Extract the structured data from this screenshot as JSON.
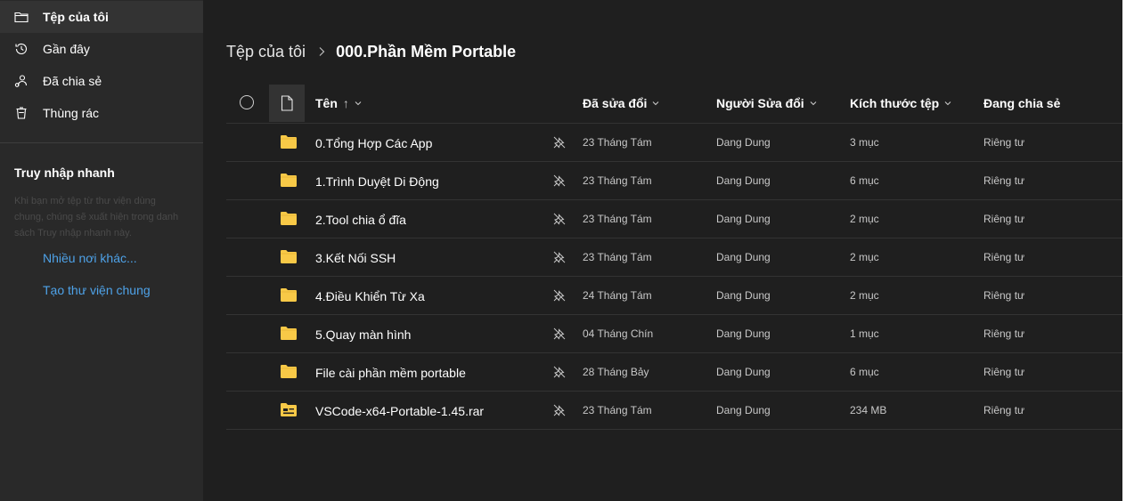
{
  "sidebar": {
    "nav": [
      {
        "label": "Tệp của tôi",
        "icon": "folder-icon"
      },
      {
        "label": "Gần đây",
        "icon": "recent-icon"
      },
      {
        "label": "Đã chia sẻ",
        "icon": "shared-icon"
      },
      {
        "label": "Thùng rác",
        "icon": "recycle-bin-icon"
      }
    ],
    "quick_access": {
      "title": "Truy nhập nhanh",
      "description": "Khi bạn mở tệp từ thư viện dùng chung, chúng sẽ xuất hiện trong danh sách Truy nhập nhanh này.",
      "links": [
        "Nhiều nơi khác...",
        "Tạo thư viện chung"
      ]
    }
  },
  "breadcrumb": {
    "root": "Tệp của tôi",
    "current": "000.Phần Mềm Portable"
  },
  "columns": {
    "name": "Tên",
    "sort_arrow": "↑",
    "modified": "Đã sửa đổi",
    "modified_by": "Người Sửa đổi",
    "size": "Kích thước tệp",
    "sharing": "Đang chia sẻ"
  },
  "files": [
    {
      "name": "0.Tổng Hợp Các App",
      "type": "folder",
      "modified": "23 Tháng Tám",
      "modified_by": "Dang Dung",
      "size": "3 mục",
      "sharing": "Riêng tư"
    },
    {
      "name": "1.Trình Duyệt Di Động",
      "type": "folder",
      "modified": "23 Tháng Tám",
      "modified_by": "Dang Dung",
      "size": "6 mục",
      "sharing": "Riêng tư"
    },
    {
      "name": "2.Tool chia ổ đĩa",
      "type": "folder",
      "modified": "23 Tháng Tám",
      "modified_by": "Dang Dung",
      "size": "2 mục",
      "sharing": "Riêng tư"
    },
    {
      "name": "3.Kết Nối SSH",
      "type": "folder",
      "modified": "23 Tháng Tám",
      "modified_by": "Dang Dung",
      "size": "2 mục",
      "sharing": "Riêng tư"
    },
    {
      "name": "4.Điều Khiển Từ Xa",
      "type": "folder",
      "modified": "24 Tháng Tám",
      "modified_by": "Dang Dung",
      "size": "2 mục",
      "sharing": "Riêng tư"
    },
    {
      "name": "5.Quay màn hình",
      "type": "folder",
      "modified": "04 Tháng Chín",
      "modified_by": "Dang Dung",
      "size": "1 mục",
      "sharing": "Riêng tư"
    },
    {
      "name": "File cài phần mềm portable",
      "type": "folder",
      "modified": "28 Tháng Bảy",
      "modified_by": "Dang Dung",
      "size": "6 mục",
      "sharing": "Riêng tư"
    },
    {
      "name": "VSCode-x64-Portable-1.45.rar",
      "type": "archive",
      "modified": "23 Tháng Tám",
      "modified_by": "Dang Dung",
      "size": "234 MB",
      "sharing": "Riêng tư"
    }
  ],
  "colors": {
    "folder": "#f8c947",
    "link": "#4ea2e8",
    "sidebar_bg": "#292929",
    "main_bg": "#1f1f1f"
  }
}
